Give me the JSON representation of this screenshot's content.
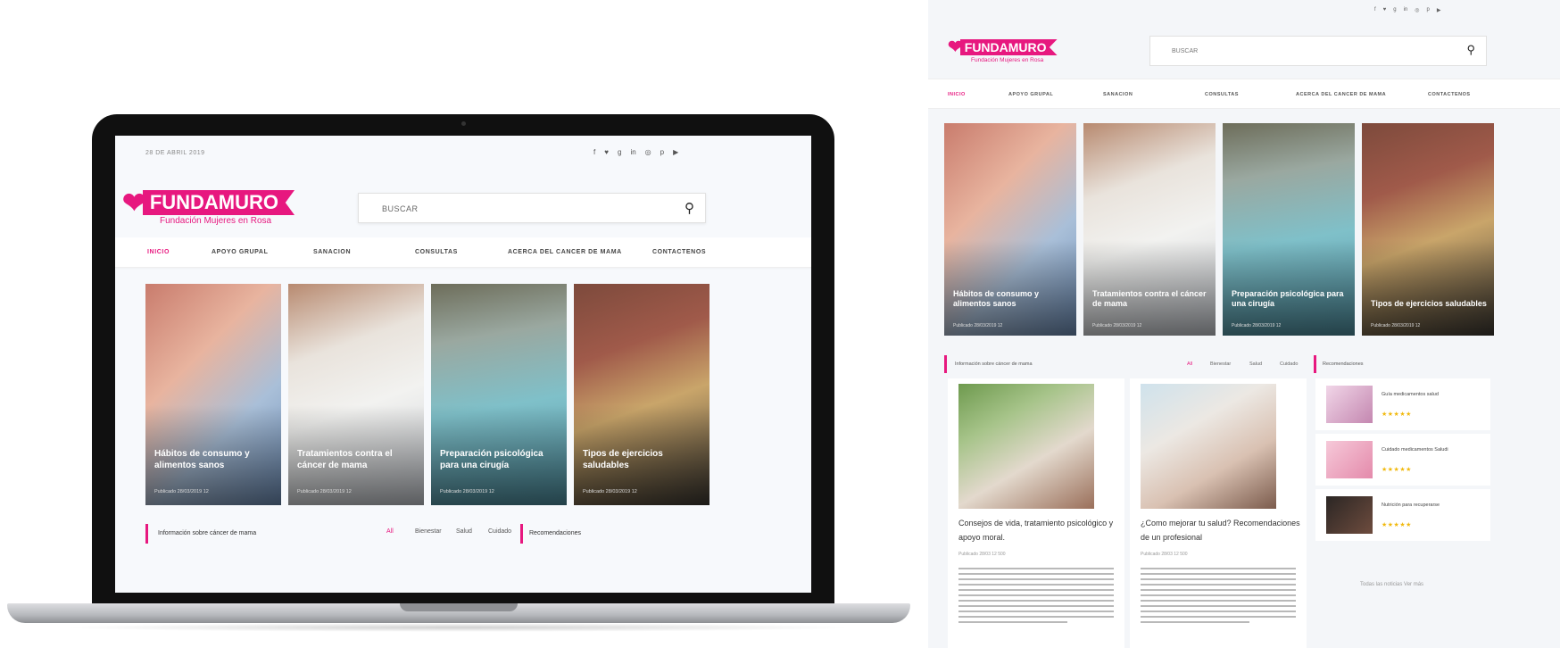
{
  "laptop": {
    "date": "28 DE ABRIL 2019",
    "social_icons": [
      "facebook-icon",
      "twitter-icon",
      "google-plus-icon",
      "linkedin-icon",
      "instagram-icon",
      "pinterest-icon",
      "youtube-icon"
    ],
    "logo": {
      "name": "FUNDAMURO",
      "tagline": "Fundación Mujeres en Rosa"
    },
    "search_placeholder": "BUSCAR",
    "nav": [
      "INICIO",
      "APOYO GRUPAL",
      "SANACION",
      "CONSULTAS",
      "ACERCA DEL CANCER DE MAMA",
      "CONTACTENOS"
    ],
    "cards": [
      {
        "title": "Hábitos de consumo y alimentos sanos",
        "meta": "Publicado 28/03/2019   12"
      },
      {
        "title": "Tratamientos contra el cáncer de mama",
        "meta": "Publicado 28/03/2019   12"
      },
      {
        "title": "Preparación psicológica para una cirugía",
        "meta": "Publicado 28/03/2019   12"
      },
      {
        "title": "Tipos de ejercicios saludables",
        "meta": "Publicado 28/03/2019   12"
      }
    ],
    "section": {
      "label": "Información sobre cáncer de mama",
      "filters": [
        "All",
        "Bienestar",
        "Salud",
        "Cuidado"
      ]
    },
    "recommendations_label": "Recomendaciones"
  },
  "desktop": {
    "social_icons": [
      "facebook-icon",
      "twitter-icon",
      "google-plus-icon",
      "linkedin-icon",
      "instagram-icon",
      "pinterest-icon",
      "youtube-icon"
    ],
    "logo": {
      "name": "FUNDAMURO",
      "tagline": "Fundación Mujeres en Rosa"
    },
    "search_placeholder": "BUSCAR",
    "nav": [
      "INICIO",
      "APOYO GRUPAL",
      "SANACION",
      "CONSULTAS",
      "ACERCA DEL CANCER DE MAMA",
      "CONTACTENOS"
    ],
    "cards": [
      {
        "title": "Hábitos de consumo y alimentos sanos",
        "meta": "Publicado 28/03/2019   12"
      },
      {
        "title": "Tratamientos contra el cáncer de mama",
        "meta": "Publicado 28/03/2019   12"
      },
      {
        "title": "Preparación psicológica para una cirugía",
        "meta": "Publicado 28/03/2019   12"
      },
      {
        "title": "Tipos de ejercicios saludables",
        "meta": "Publicado 28/03/2019   12"
      }
    ],
    "section": {
      "label": "Información sobre cáncer de mama",
      "filters": [
        "All",
        "Bienestar",
        "Salud",
        "Cuidado"
      ]
    },
    "recommendations_label": "Recomendaciones",
    "articles": [
      {
        "title": "Consejos de vida, tratamiento psicológico y apoyo moral.",
        "meta": "Publicado 28/03   12   500"
      },
      {
        "title": "¿Como mejorar tu salud? Recomendaciones de un profesional",
        "meta": "Publicado 28/03   12   500"
      }
    ],
    "recommendations": [
      {
        "name": "Guía medicamentos salud",
        "stars": "★★★★★"
      },
      {
        "name": "Cuidado medicamentos Saludi",
        "stars": "★★★★★"
      },
      {
        "name": "Nutrición para recuperarse",
        "stars": "★★★★★"
      }
    ],
    "footer_link": "Todas las noticias   Ver más"
  },
  "colors": {
    "brand": "#e7187f",
    "stars": "#f1b90e"
  }
}
